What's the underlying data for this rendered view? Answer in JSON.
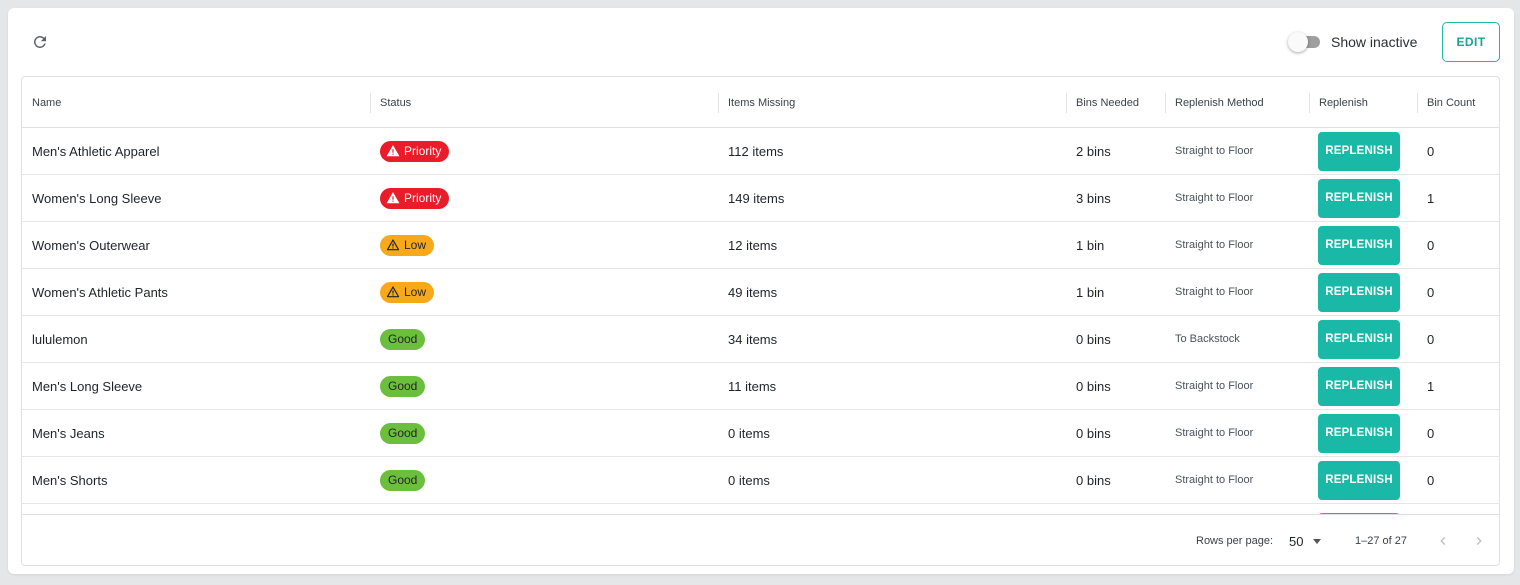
{
  "toolbar": {
    "refresh_icon": "refresh-icon",
    "show_inactive_label": "Show inactive",
    "show_inactive_on": false,
    "edit_label": "EDIT"
  },
  "table": {
    "columns": [
      {
        "key": "name",
        "label": "Name"
      },
      {
        "key": "status",
        "label": "Status"
      },
      {
        "key": "items_missing",
        "label": "Items Missing"
      },
      {
        "key": "bins_needed",
        "label": "Bins Needed"
      },
      {
        "key": "replenish_method",
        "label": "Replenish Method"
      },
      {
        "key": "replenish",
        "label": "Replenish"
      },
      {
        "key": "bin_count",
        "label": "Bin Count"
      }
    ],
    "replenish_button_label": "REPLENISH",
    "rows": [
      {
        "name": "Men's Athletic Apparel",
        "status": "Priority",
        "status_type": "priority",
        "items_missing": "112 items",
        "bins_needed": "2 bins",
        "replenish_method": "Straight to Floor",
        "bin_count": "0"
      },
      {
        "name": "Women's Long Sleeve",
        "status": "Priority",
        "status_type": "priority",
        "items_missing": "149 items",
        "bins_needed": "3 bins",
        "replenish_method": "Straight to Floor",
        "bin_count": "1"
      },
      {
        "name": "Women's Outerwear",
        "status": "Low",
        "status_type": "low",
        "items_missing": "12 items",
        "bins_needed": "1 bin",
        "replenish_method": "Straight to Floor",
        "bin_count": "0"
      },
      {
        "name": "Women's Athletic Pants",
        "status": "Low",
        "status_type": "low",
        "items_missing": "49 items",
        "bins_needed": "1 bin",
        "replenish_method": "Straight to Floor",
        "bin_count": "0"
      },
      {
        "name": "lululemon",
        "status": "Good",
        "status_type": "good",
        "items_missing": "34 items",
        "bins_needed": "0 bins",
        "replenish_method": "To Backstock",
        "bin_count": "0"
      },
      {
        "name": "Men's Long Sleeve",
        "status": "Good",
        "status_type": "good",
        "items_missing": "11 items",
        "bins_needed": "0 bins",
        "replenish_method": "Straight to Floor",
        "bin_count": "1"
      },
      {
        "name": "Men's Jeans",
        "status": "Good",
        "status_type": "good",
        "items_missing": "0 items",
        "bins_needed": "0 bins",
        "replenish_method": "Straight to Floor",
        "bin_count": "0"
      },
      {
        "name": "Men's Shorts",
        "status": "Good",
        "status_type": "good",
        "items_missing": "0 items",
        "bins_needed": "0 bins",
        "replenish_method": "Straight to Floor",
        "bin_count": "0"
      }
    ]
  },
  "pagination": {
    "rows_per_page_label": "Rows per page:",
    "rows_per_page_value": "50",
    "range_text": "1–27 of 27",
    "prev_icon": "chevron-left-icon",
    "next_icon": "chevron-right-icon"
  },
  "colors": {
    "accent": "#1ab8a6",
    "priority": "#eb1c2a",
    "low": "#f7a91b",
    "good": "#6cbf3c"
  }
}
